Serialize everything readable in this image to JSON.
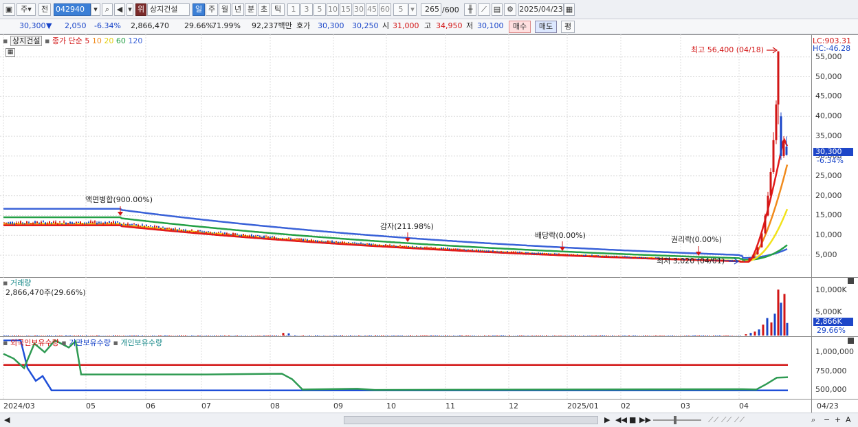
{
  "toolbar": {
    "period_label": "주",
    "prefix_label": "전",
    "stock_code": "042940",
    "market_badge": "위",
    "stock_name": "상지건설",
    "period_buttons": [
      "일",
      "주",
      "월",
      "년",
      "분",
      "초",
      "틱"
    ],
    "interval_buttons": [
      "1",
      "3",
      "5",
      "10",
      "15",
      "30",
      "45",
      "60"
    ],
    "interval_value": "5",
    "count_current": "265",
    "count_total": "/600",
    "date": "2025/04/23"
  },
  "quote": {
    "price": "30,300",
    "arrow": "▼",
    "change": "2,050",
    "change_pct": "-6.34%",
    "volume": "2,866,470",
    "turnover_pct": "29.66%",
    "ratio_pct": "71.99%",
    "amount": "92,237백만",
    "hoga_label": "호가",
    "ask": "30,300",
    "bid": "30,250",
    "open_label": "시",
    "open": "31,000",
    "high_label": "고",
    "high": "34,950",
    "low_label": "저",
    "low": "30,100",
    "buy_label": "매수",
    "sell_label": "매도",
    "avg_label": "평"
  },
  "legend": {
    "name": "상지건설",
    "ma_label": "종가 단순",
    "ma5": "5",
    "ma10": "10",
    "ma20": "20",
    "ma60": "60",
    "ma120": "120"
  },
  "price_panel": {
    "lc": "LC:903.31",
    "hc": "HC:-46.28",
    "y_ticks": [
      "55,000",
      "50,000",
      "45,000",
      "40,000",
      "35,000",
      "30,000",
      "25,000",
      "20,000",
      "15,000",
      "10,000",
      "5,000"
    ],
    "current_tag": "30,300",
    "current_pct": "-6.34%",
    "annotations": {
      "max": "최고 56,400 (04/18)",
      "min": "최저 3,020 (04/01)",
      "split": "액면병합(900.00%)",
      "reduction": "감자(211.98%)",
      "dividend": "배당락(0.00%)",
      "rights": "권리락(0.00%)"
    }
  },
  "volume_panel": {
    "title": "거래량",
    "value": "2,866,470주(29.66%)",
    "y_ticks": [
      "10,000K",
      "5,000K"
    ],
    "current_tag": "2,866K",
    "current_pct": "29.66%"
  },
  "holding_panel": {
    "foreign": "외국인보유수량",
    "inst": "기관보유수량",
    "indiv": "개인보유수량",
    "y_ticks": [
      "1,000,000",
      "750,000",
      "500,000"
    ]
  },
  "x_axis": [
    "2024/03",
    "05",
    "06",
    "07",
    "08",
    "09",
    "10",
    "11",
    "12",
    "2025/01",
    "02",
    "03",
    "04"
  ],
  "x_end_label": "04/23",
  "colors": {
    "up": "#d21515",
    "down": "#1844c8",
    "ma5": "#e31b1b",
    "ma10": "#f08a1c",
    "ma20": "#f2e21a",
    "ma60": "#24a046",
    "ma120": "#3a62d8"
  }
}
